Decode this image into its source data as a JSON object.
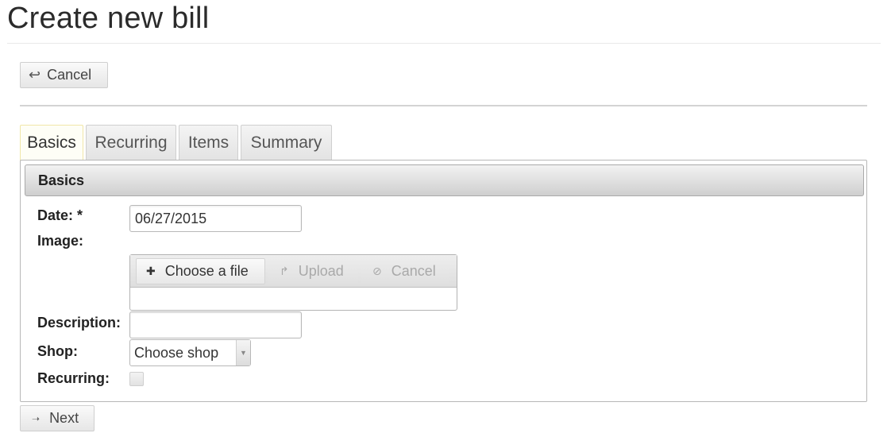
{
  "page": {
    "title": "Create new bill"
  },
  "toolbar": {
    "cancel_label": "Cancel"
  },
  "tabs": [
    {
      "label": "Basics",
      "active": true
    },
    {
      "label": "Recurring",
      "active": false
    },
    {
      "label": "Items",
      "active": false
    },
    {
      "label": "Summary",
      "active": false
    }
  ],
  "panel": {
    "title": "Basics",
    "date": {
      "label": "Date: *",
      "value": "06/27/2015"
    },
    "image": {
      "label": "Image:",
      "choose_label": "Choose a file",
      "upload_label": "Upload",
      "cancel_label": "Cancel"
    },
    "description": {
      "label": "Description:",
      "value": ""
    },
    "shop": {
      "label": "Shop:",
      "selected": "Choose shop"
    },
    "recurring": {
      "label": "Recurring:",
      "checked": false
    }
  },
  "footer": {
    "next_label": "Next"
  },
  "icons": {
    "cancel": "reply-arrow-icon",
    "choose": "plus-icon",
    "upload": "upload-arrow-icon",
    "upload_cancel": "cancel-circle-icon",
    "next": "arrow-right-icon",
    "select": "chevron-down-icon"
  }
}
